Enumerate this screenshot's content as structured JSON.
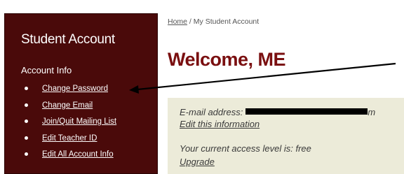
{
  "breadcrumb": {
    "home_label": "Home",
    "separator": " / ",
    "current": "My Student Account"
  },
  "sidebar": {
    "title": "Student Account",
    "section_label": "Account Info",
    "items": [
      {
        "label": "Change Password"
      },
      {
        "label": "Change Email"
      },
      {
        "label": "Join/Quit Mailing List"
      },
      {
        "label": "Edit Teacher ID"
      },
      {
        "label": "Edit All Account Info"
      }
    ]
  },
  "main": {
    "title": "Welcome, ME",
    "email_label": "E-mail address:",
    "email_visible_tail": "m",
    "edit_info_link": "Edit this information",
    "access_level_text": "Your current access level is: free",
    "upgrade_link": "Upgrade"
  },
  "colors": {
    "sidebar_bg": "#4a0a0a",
    "title_color": "#7a0f10",
    "info_box_bg": "#ecebd9",
    "annotation_arrow": "#000000"
  }
}
